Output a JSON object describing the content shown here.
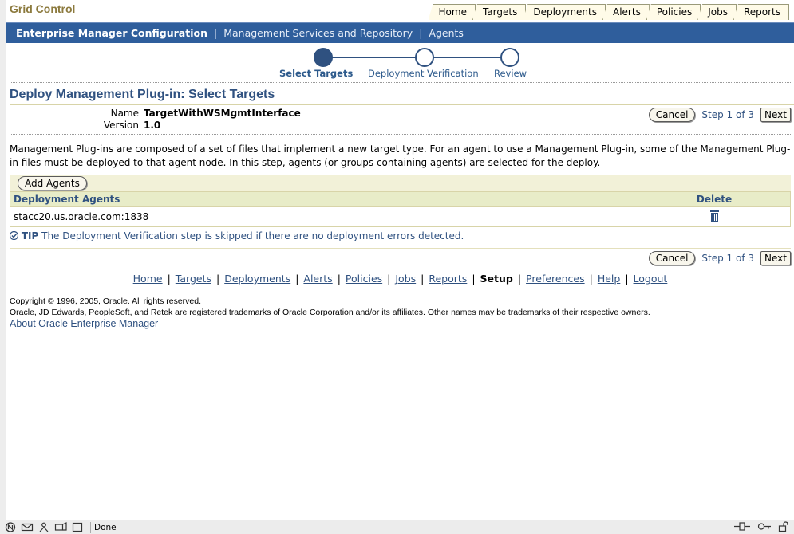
{
  "header": {
    "brand": "Grid Control",
    "tabs": [
      "Home",
      "Targets",
      "Deployments",
      "Alerts",
      "Policies",
      "Jobs",
      "Reports"
    ]
  },
  "subnav": {
    "active": "Enterprise Manager Configuration",
    "links": [
      "Management Services and Repository",
      "Agents"
    ]
  },
  "train": {
    "steps": [
      "Select Targets",
      "Deployment Verification",
      "Review"
    ]
  },
  "page": {
    "title": "Deploy Management Plug-in: Select Targets",
    "name_label": "Name",
    "name_value": "TargetWithWSMgmtInterface",
    "version_label": "Version",
    "version_value": "1.0",
    "cancel_label": "Cancel",
    "step_text": "Step 1 of 3",
    "next_label": "Next",
    "description": "Management Plug-ins are composed of a set of files that implement a new target type. For an agent to use a Management Plug-in, some of the Management Plug-in files must be deployed to that agent node. In this step, agents (or groups containing agents) are selected for the deploy.",
    "add_agents_label": "Add Agents",
    "table": {
      "col_agents": "Deployment Agents",
      "col_delete": "Delete",
      "rows": [
        {
          "agent": "stacc20.us.oracle.com:1838"
        }
      ]
    },
    "tip_label": "TIP",
    "tip_text": "The Deployment Verification step is skipped if there are no deployment errors detected."
  },
  "footer": {
    "links": [
      "Home",
      "Targets",
      "Deployments",
      "Alerts",
      "Policies",
      "Jobs",
      "Reports",
      "Setup",
      "Preferences",
      "Help",
      "Logout"
    ],
    "current": "Setup",
    "copyright": "Copyright © 1996, 2005, Oracle. All rights reserved.",
    "trademark": "Oracle, JD Edwards, PeopleSoft, and Retek are registered trademarks of Oracle Corporation and/or its affiliates. Other names may be trademarks of their respective owners.",
    "about": "About Oracle Enterprise Manager"
  },
  "statusbar": {
    "text": "Done"
  },
  "colors": {
    "nav_blue": "#2f5e9c",
    "link_blue": "#2f5180",
    "tab_bg": "#fffbe8",
    "table_header": "#e8ecc8"
  }
}
